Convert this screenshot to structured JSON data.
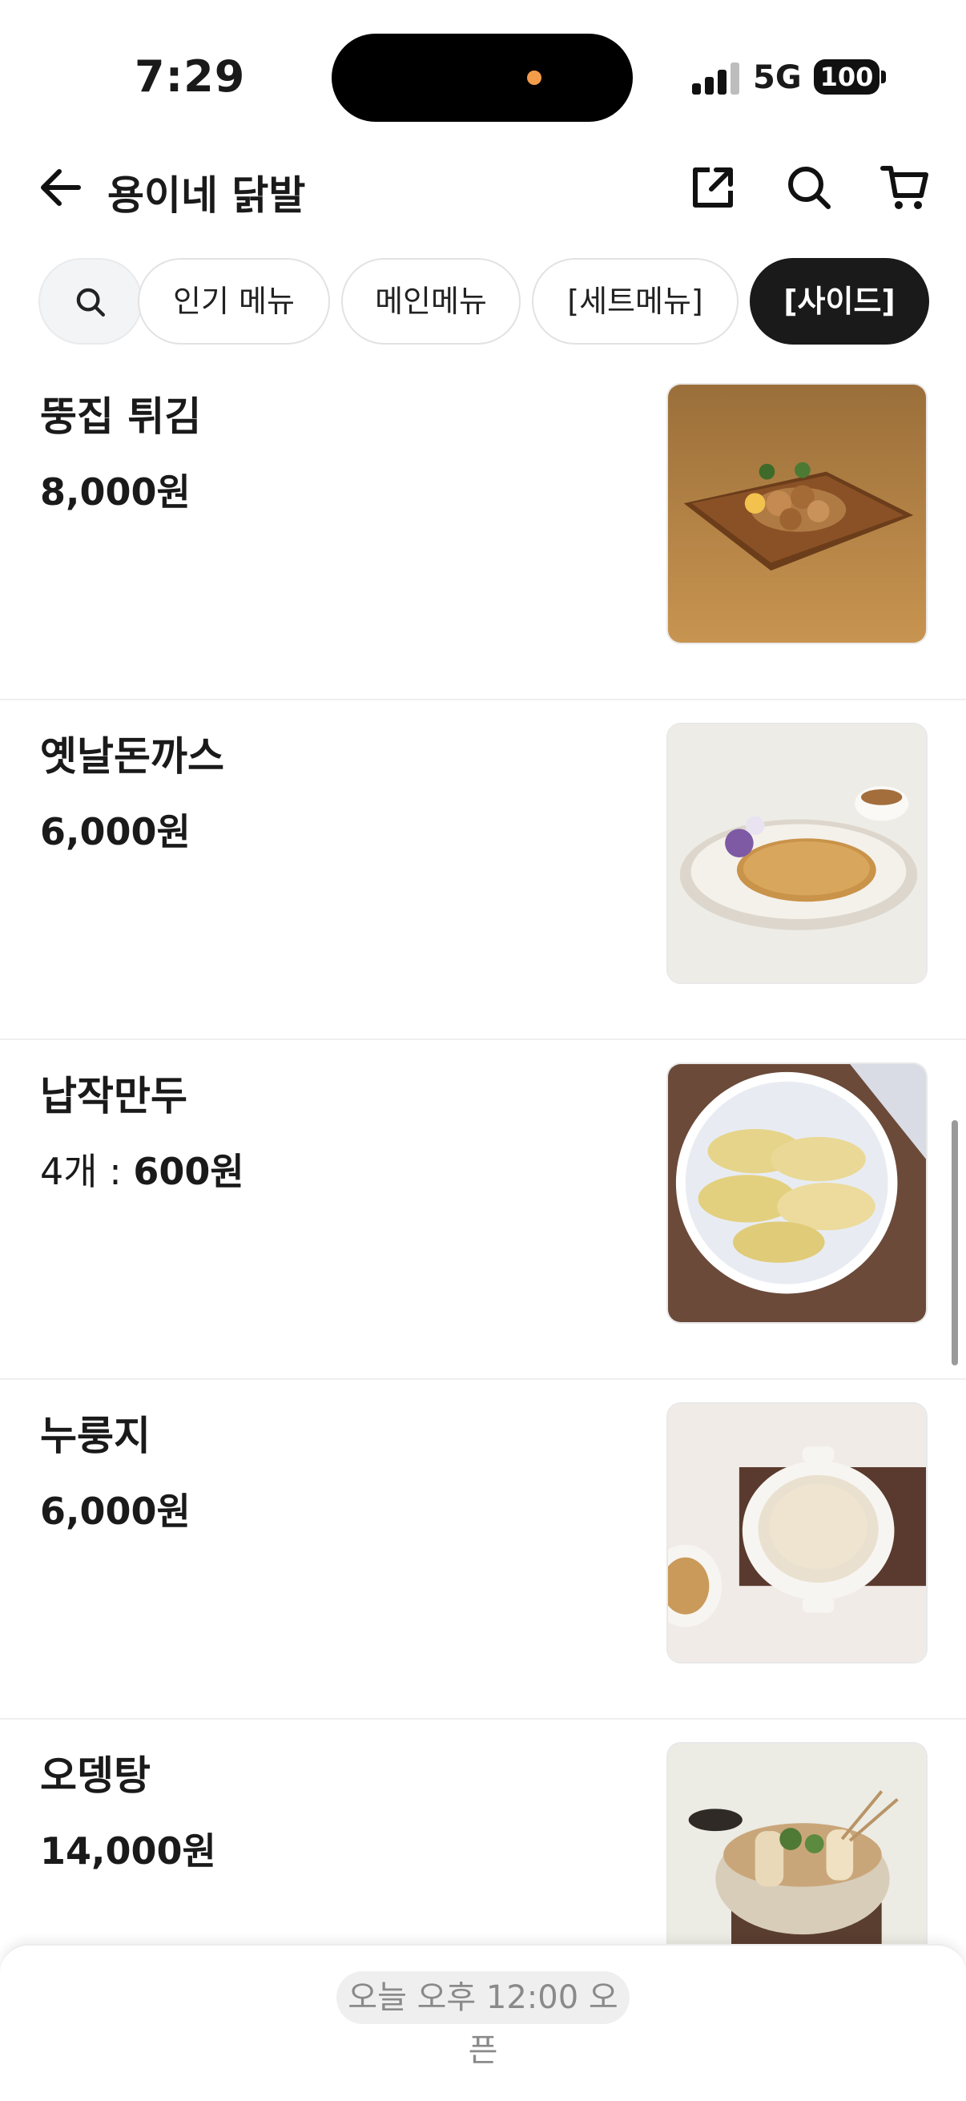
{
  "status_bar": {
    "time": "7:29",
    "network": "5G",
    "battery": "100"
  },
  "header": {
    "store_name": "용이네 닭발",
    "icons": [
      "back-arrow-icon",
      "share-icon",
      "search-icon",
      "cart-icon"
    ]
  },
  "categories": [
    {
      "label": "인기 메뉴",
      "active": false
    },
    {
      "label": "메인메뉴",
      "active": false
    },
    {
      "label": "[세트메뉴]",
      "active": false
    },
    {
      "label": "[사이드]",
      "active": true
    }
  ],
  "menu_items": [
    {
      "name": "뚱집 튀김",
      "price_prefix": "",
      "price": "8,000원",
      "image": "fried-chicken-image"
    },
    {
      "name": "옛날돈까스",
      "price_prefix": "",
      "price": "6,000원",
      "image": "pork-cutlet-image"
    },
    {
      "name": "납작만두",
      "price_prefix": "4개 : ",
      "price": "600원",
      "image": "flat-dumplings-image"
    },
    {
      "name": "누룽지",
      "price_prefix": "",
      "price": "6,000원",
      "image": "scorched-rice-porridge-image"
    },
    {
      "name": "오뎅탕",
      "price_prefix": "",
      "price": "14,000원",
      "image": "fish-cake-soup-image"
    }
  ],
  "bottom_bar": {
    "open_notice": "오늘 오후 12:00 오픈"
  },
  "colors": {
    "active_chip": "#1a1a1a",
    "chip_border": "#e2e2e2",
    "notice_text": "#8a8a8a"
  }
}
